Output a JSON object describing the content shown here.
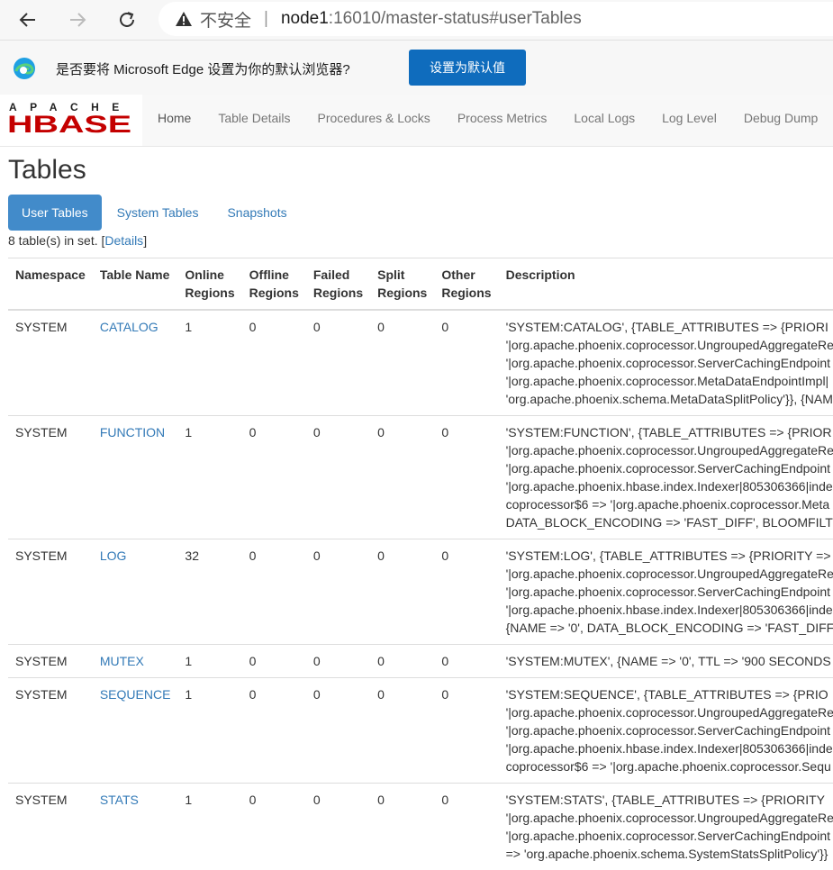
{
  "browser": {
    "insecure_label": "不安全",
    "url_host": "node1",
    "url_path": ":16010/master-status#userTables"
  },
  "infobar": {
    "message": "是否要将 Microsoft Edge 设置为你的默认浏览器?",
    "button": "设置为默认值"
  },
  "logo": {
    "top_text": "APACHE",
    "main_text": "HBASE"
  },
  "nav": [
    "Home",
    "Table Details",
    "Procedures & Locks",
    "Process Metrics",
    "Local Logs",
    "Log Level",
    "Debug Dump"
  ],
  "page": {
    "title": "Tables",
    "tabs": [
      "User Tables",
      "System Tables",
      "Snapshots"
    ],
    "count_prefix": "8 table(s) in set. [",
    "count_link": "Details",
    "count_suffix": "]"
  },
  "table": {
    "headers": [
      [
        "Namespace"
      ],
      [
        "Table Name"
      ],
      [
        "Online",
        "Regions"
      ],
      [
        "Offline",
        "Regions"
      ],
      [
        "Failed",
        "Regions"
      ],
      [
        "Split",
        "Regions"
      ],
      [
        "Other",
        "Regions"
      ],
      [
        "Description"
      ]
    ],
    "rows": [
      {
        "ns": "SYSTEM",
        "name": "CATALOG",
        "online": "1",
        "offline": "0",
        "failed": "0",
        "split": "0",
        "other": "0",
        "desc": [
          "'SYSTEM:CATALOG', {TABLE_ATTRIBUTES => {PRIORI",
          "'|org.apache.phoenix.coprocessor.UngroupedAggregateRe",
          "'|org.apache.phoenix.coprocessor.ServerCachingEndpoint",
          "'|org.apache.phoenix.coprocessor.MetaDataEndpointImpl|",
          "'org.apache.phoenix.schema.MetaDataSplitPolicy'}}, {NAM"
        ]
      },
      {
        "ns": "SYSTEM",
        "name": "FUNCTION",
        "online": "1",
        "offline": "0",
        "failed": "0",
        "split": "0",
        "other": "0",
        "desc": [
          "'SYSTEM:FUNCTION', {TABLE_ATTRIBUTES => {PRIOR",
          "'|org.apache.phoenix.coprocessor.UngroupedAggregateRe",
          "'|org.apache.phoenix.coprocessor.ServerCachingEndpoint",
          "'|org.apache.phoenix.hbase.index.Indexer|805306366|inde",
          "coprocessor$6 => '|org.apache.phoenix.coprocessor.Meta",
          "DATA_BLOCK_ENCODING => 'FAST_DIFF', BLOOMFILT"
        ]
      },
      {
        "ns": "SYSTEM",
        "name": "LOG",
        "online": "32",
        "offline": "0",
        "failed": "0",
        "split": "0",
        "other": "0",
        "desc": [
          "'SYSTEM:LOG', {TABLE_ATTRIBUTES => {PRIORITY =>",
          "'|org.apache.phoenix.coprocessor.UngroupedAggregateRe",
          "'|org.apache.phoenix.coprocessor.ServerCachingEndpoint",
          "'|org.apache.phoenix.hbase.index.Indexer|805306366|inde",
          "{NAME => '0', DATA_BLOCK_ENCODING => 'FAST_DIFF"
        ]
      },
      {
        "ns": "SYSTEM",
        "name": "MUTEX",
        "online": "1",
        "offline": "0",
        "failed": "0",
        "split": "0",
        "other": "0",
        "desc": [
          "'SYSTEM:MUTEX', {NAME => '0', TTL => '900 SECONDS"
        ]
      },
      {
        "ns": "SYSTEM",
        "name": "SEQUENCE",
        "online": "1",
        "offline": "0",
        "failed": "0",
        "split": "0",
        "other": "0",
        "desc": [
          "'SYSTEM:SEQUENCE', {TABLE_ATTRIBUTES => {PRIO",
          "'|org.apache.phoenix.coprocessor.UngroupedAggregateRe",
          "'|org.apache.phoenix.coprocessor.ServerCachingEndpoint",
          "'|org.apache.phoenix.hbase.index.Indexer|805306366|inde",
          "coprocessor$6 => '|org.apache.phoenix.coprocessor.Sequ"
        ]
      },
      {
        "ns": "SYSTEM",
        "name": "STATS",
        "online": "1",
        "offline": "0",
        "failed": "0",
        "split": "0",
        "other": "0",
        "desc": [
          "'SYSTEM:STATS', {TABLE_ATTRIBUTES => {PRIORITY",
          "'|org.apache.phoenix.coprocessor.UngroupedAggregateRe",
          "'|org.apache.phoenix.coprocessor.ServerCachingEndpoint",
          "=> 'org.apache.phoenix.schema.SystemStatsSplitPolicy'}}"
        ]
      }
    ]
  }
}
